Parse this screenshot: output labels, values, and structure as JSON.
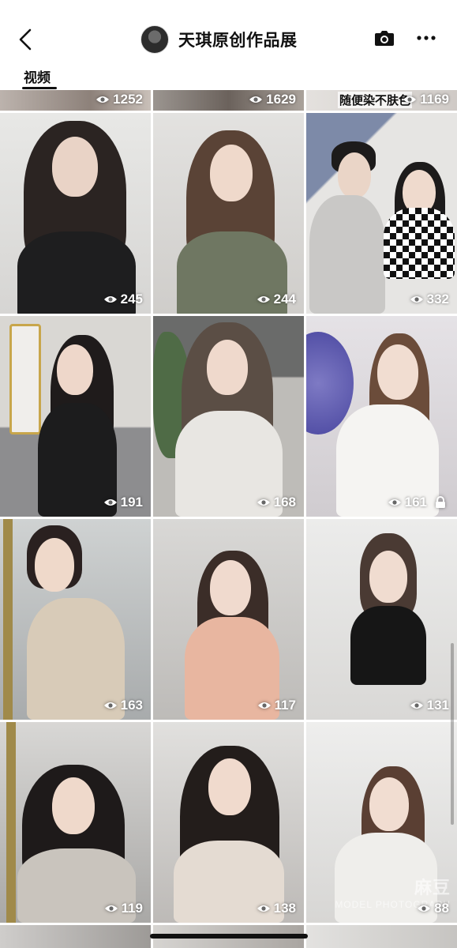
{
  "header": {
    "title": "天琪原创作品展"
  },
  "tabs": [
    {
      "label": "视频",
      "active": true
    }
  ],
  "top_row": [
    {
      "views": "1252"
    },
    {
      "views": "1629"
    },
    {
      "views": "1169",
      "caption": "随便染不肤色"
    }
  ],
  "rows": [
    [
      {
        "views": "245"
      },
      {
        "views": "244"
      },
      {
        "views": "332"
      }
    ],
    [
      {
        "views": "191"
      },
      {
        "views": "168"
      },
      {
        "views": "161",
        "locked": true
      }
    ],
    [
      {
        "views": "163"
      },
      {
        "views": "117"
      },
      {
        "views": "131"
      }
    ],
    [
      {
        "views": "119"
      },
      {
        "views": "138"
      },
      {
        "views": "88"
      }
    ]
  ],
  "watermark": {
    "line1": "麻豆",
    "line2": "MODEL PHOTOGRAPH"
  },
  "colors": {
    "accent": "#111111",
    "background": "#ffffff"
  },
  "icons": [
    "back-icon",
    "camera-icon",
    "more-icon",
    "eye-icon",
    "lock-icon"
  ]
}
